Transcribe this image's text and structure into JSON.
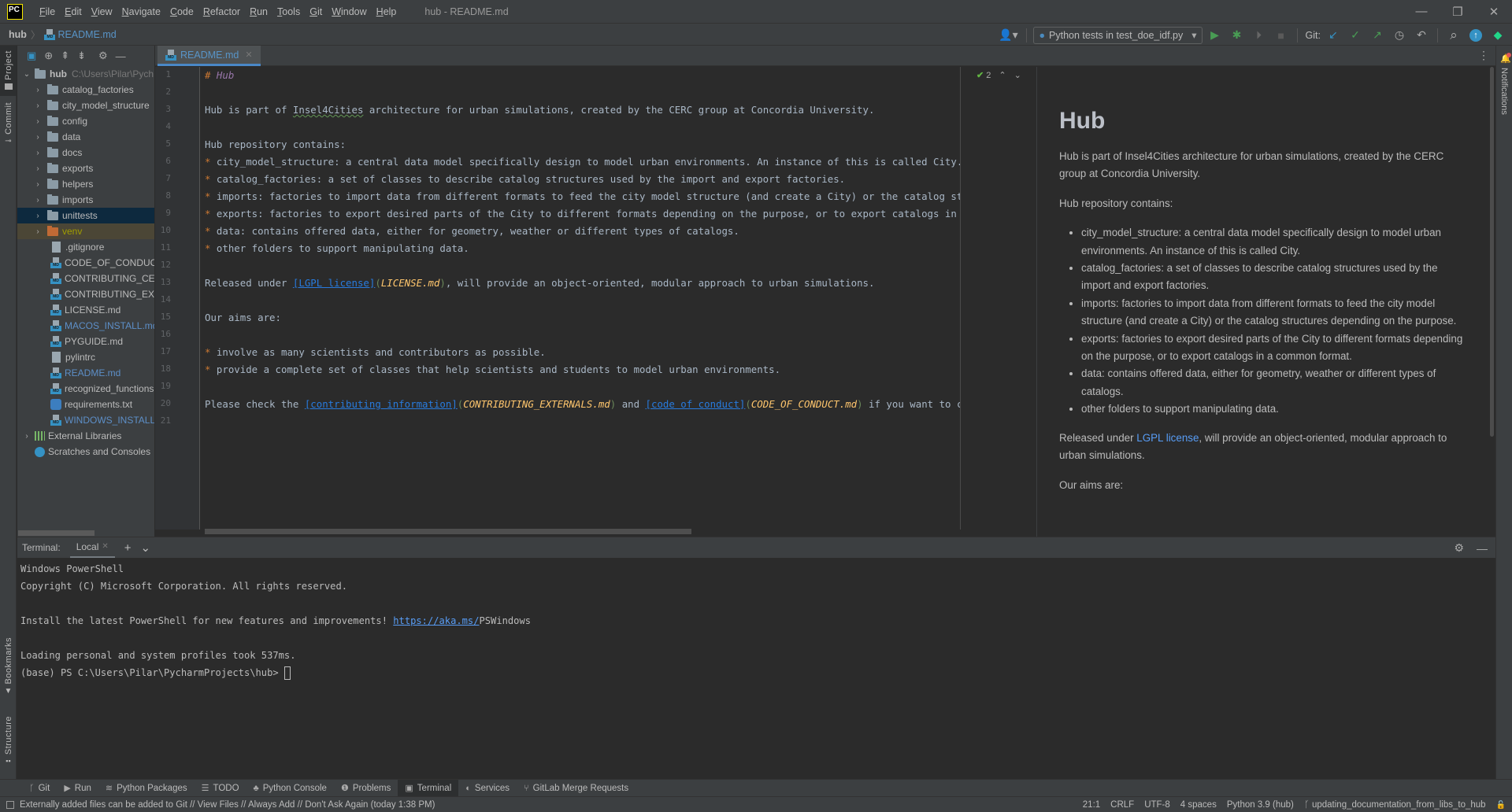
{
  "app": {
    "logo": "PC",
    "window_title": "hub - README.md",
    "menu": [
      "File",
      "Edit",
      "View",
      "Navigate",
      "Code",
      "Refactor",
      "Run",
      "Tools",
      "Git",
      "Window",
      "Help"
    ],
    "window_controls": {
      "minimize": "—",
      "restore": "❐",
      "close": "✕"
    }
  },
  "navbar": {
    "breadcrumb_root": "hub",
    "breadcrumb_sep": "〉",
    "breadcrumb_file": "README.md",
    "run_config": "Python tests in test_doe_idf.py",
    "git_label": "Git:",
    "icons": {
      "user": "👤▾",
      "dropdown": "▾",
      "run": "▶",
      "debug": "✱",
      "coverage": "⏵",
      "stop": "■",
      "git_update": "↙",
      "git_commit": "✓",
      "git_push": "↗",
      "history": "◷",
      "rollback": "↶",
      "search": "⌕",
      "update": "↑",
      "plugin": "◆"
    }
  },
  "left_strip": {
    "project": "Project",
    "commit": "Commit",
    "bookmarks": "Bookmarks",
    "structure": "Structure"
  },
  "right_strip": {
    "notifications": "Notifications"
  },
  "project_toolbar": {
    "icons": [
      "▣",
      "⊕",
      "⇞",
      "⇟",
      "⚙",
      "—"
    ]
  },
  "project": {
    "root": {
      "name": "hub",
      "path": "C:\\Users\\Pilar\\Pych"
    },
    "folders": [
      {
        "name": "catalog_factories"
      },
      {
        "name": "city_model_structure"
      },
      {
        "name": "config"
      },
      {
        "name": "data"
      },
      {
        "name": "docs"
      },
      {
        "name": "exports"
      },
      {
        "name": "helpers"
      },
      {
        "name": "imports"
      },
      {
        "name": "unittests"
      },
      {
        "name": "venv"
      }
    ],
    "files": [
      {
        "name": ".gitignore"
      },
      {
        "name": "CODE_OF_CONDUCT"
      },
      {
        "name": "CONTRIBUTING_CEN"
      },
      {
        "name": "CONTRIBUTING_EXTE"
      },
      {
        "name": "LICENSE.md"
      },
      {
        "name": "MACOS_INSTALL.md"
      },
      {
        "name": "PYGUIDE.md"
      },
      {
        "name": "pylintrc"
      },
      {
        "name": "README.md"
      },
      {
        "name": "recognized_functions"
      },
      {
        "name": "requirements.txt"
      },
      {
        "name": "WINDOWS_INSTALL.r"
      }
    ],
    "external_libraries": "External Libraries",
    "scratches": "Scratches and Consoles"
  },
  "editor": {
    "tab": "README.md",
    "tab_close": "✕",
    "more": "⋮",
    "inspection_count": "2",
    "line_numbers": [
      "1",
      "2",
      "3",
      "4",
      "5",
      "6",
      "7",
      "8",
      "9",
      "10",
      "11",
      "12",
      "13",
      "14",
      "15",
      "16",
      "17",
      "18",
      "19",
      "20",
      "21"
    ],
    "lines": {
      "l1_hash": "# ",
      "l1_title": "Hub",
      "l3_a": "Hub is part of ",
      "l3_typo": "Insel4Cities",
      "l3_b": " architecture for urban simulations, created by the CERC group at Concordia University.",
      "l5": "Hub repository contains:",
      "bullet": "* ",
      "l6": "city_model_structure: a central data model specifically design to model urban environments. An instance of this is called City.",
      "l7": "catalog_factories: a set of classes to describe catalog structures used by the import and export factories.",
      "l8": "imports: factories to import data from different formats to feed the city model structure (and create a City) or the catalog struc",
      "l9": "exports: factories to export desired parts of the City to different formats depending on the purpose, or to export catalogs in a c",
      "l10": "data: contains offered data, either for geometry, weather or different types of catalogs.",
      "l11": "other folders to support manipulating data.",
      "l13_a": "Released under ",
      "l13_link": "[LGPL license]",
      "l13_open": "(",
      "l13_url": "LICENSE.md",
      "l13_close": ")",
      "l13_b": ", will provide an object-oriented, modular approach to urban simulations.",
      "l15": "Our aims are:",
      "l17": "involve as many scientists and contributors as possible.",
      "l18": "provide a complete set of classes that help scientists and students to model urban environments.",
      "l20_a": "Please check the ",
      "l20_link1": "[contributing information]",
      "l20_url1": "CONTRIBUTING_EXTERNALS.md",
      "l20_mid": " and ",
      "l20_link2": "[code of conduct]",
      "l20_url2": "CODE_OF_CONDUCT.md",
      "l20_b": " if you want to cont"
    }
  },
  "preview": {
    "title": "Hub",
    "p1": "Hub is part of Insel4Cities architecture for urban simulations, created by the CERC group at Concordia University.",
    "p2": "Hub repository contains:",
    "items": [
      "city_model_structure: a central data model specifically design to model urban environments. An instance of this is called City.",
      "catalog_factories: a set of classes to describe catalog structures used by the import and export factories.",
      "imports: factories to import data from different formats to feed the city model structure (and create a City) or the catalog structures depending on the purpose.",
      "exports: factories to export desired parts of the City to different formats depending on the purpose, or to export catalogs in a common format.",
      "data: contains offered data, either for geometry, weather or different types of catalogs.",
      "other folders to support manipulating data."
    ],
    "p3_a": "Released under ",
    "p3_link": "LGPL license",
    "p3_b": ", will provide an object-oriented, modular approach to urban simulations.",
    "p4": "Our aims are:"
  },
  "terminal": {
    "title": "Terminal:",
    "tab": "Local",
    "tab_close": "✕",
    "add": "+",
    "dropdown": "⌄",
    "settings": "⚙",
    "minimize": "—",
    "lines": [
      "Windows PowerShell",
      "Copyright (C) Microsoft Corporation. All rights reserved.",
      "",
      "Install the latest PowerShell for new features and improvements! ",
      "",
      "Loading personal and system profiles took 537ms.",
      "(base) PS C:\\Users\\Pilar\\PycharmProjects\\hub> "
    ],
    "link": "https://aka.ms/",
    "link_tail": "PSWindows"
  },
  "tool_windows": [
    {
      "icon": "ᚴ",
      "label": "Git"
    },
    {
      "icon": "▶",
      "label": "Run"
    },
    {
      "icon": "≋",
      "label": "Python Packages"
    },
    {
      "icon": "☰",
      "label": "TODO"
    },
    {
      "icon": "♣",
      "label": "Python Console"
    },
    {
      "icon": "❶",
      "label": "Problems"
    },
    {
      "icon": "▣",
      "label": "Terminal"
    },
    {
      "icon": "◐",
      "label": "Services"
    },
    {
      "icon": "⑂",
      "label": "GitLab Merge Requests"
    }
  ],
  "status": {
    "message": "Externally added files can be added to Git // View Files // Always Add // Don't Ask Again (today 1:38 PM)",
    "position": "21:1",
    "line_sep": "CRLF",
    "encoding": "UTF-8",
    "indent": "4 spaces",
    "interpreter": "Python 3.9 (hub)",
    "branch": "updating_documentation_from_libs_to_hub",
    "lock": "🔓"
  }
}
